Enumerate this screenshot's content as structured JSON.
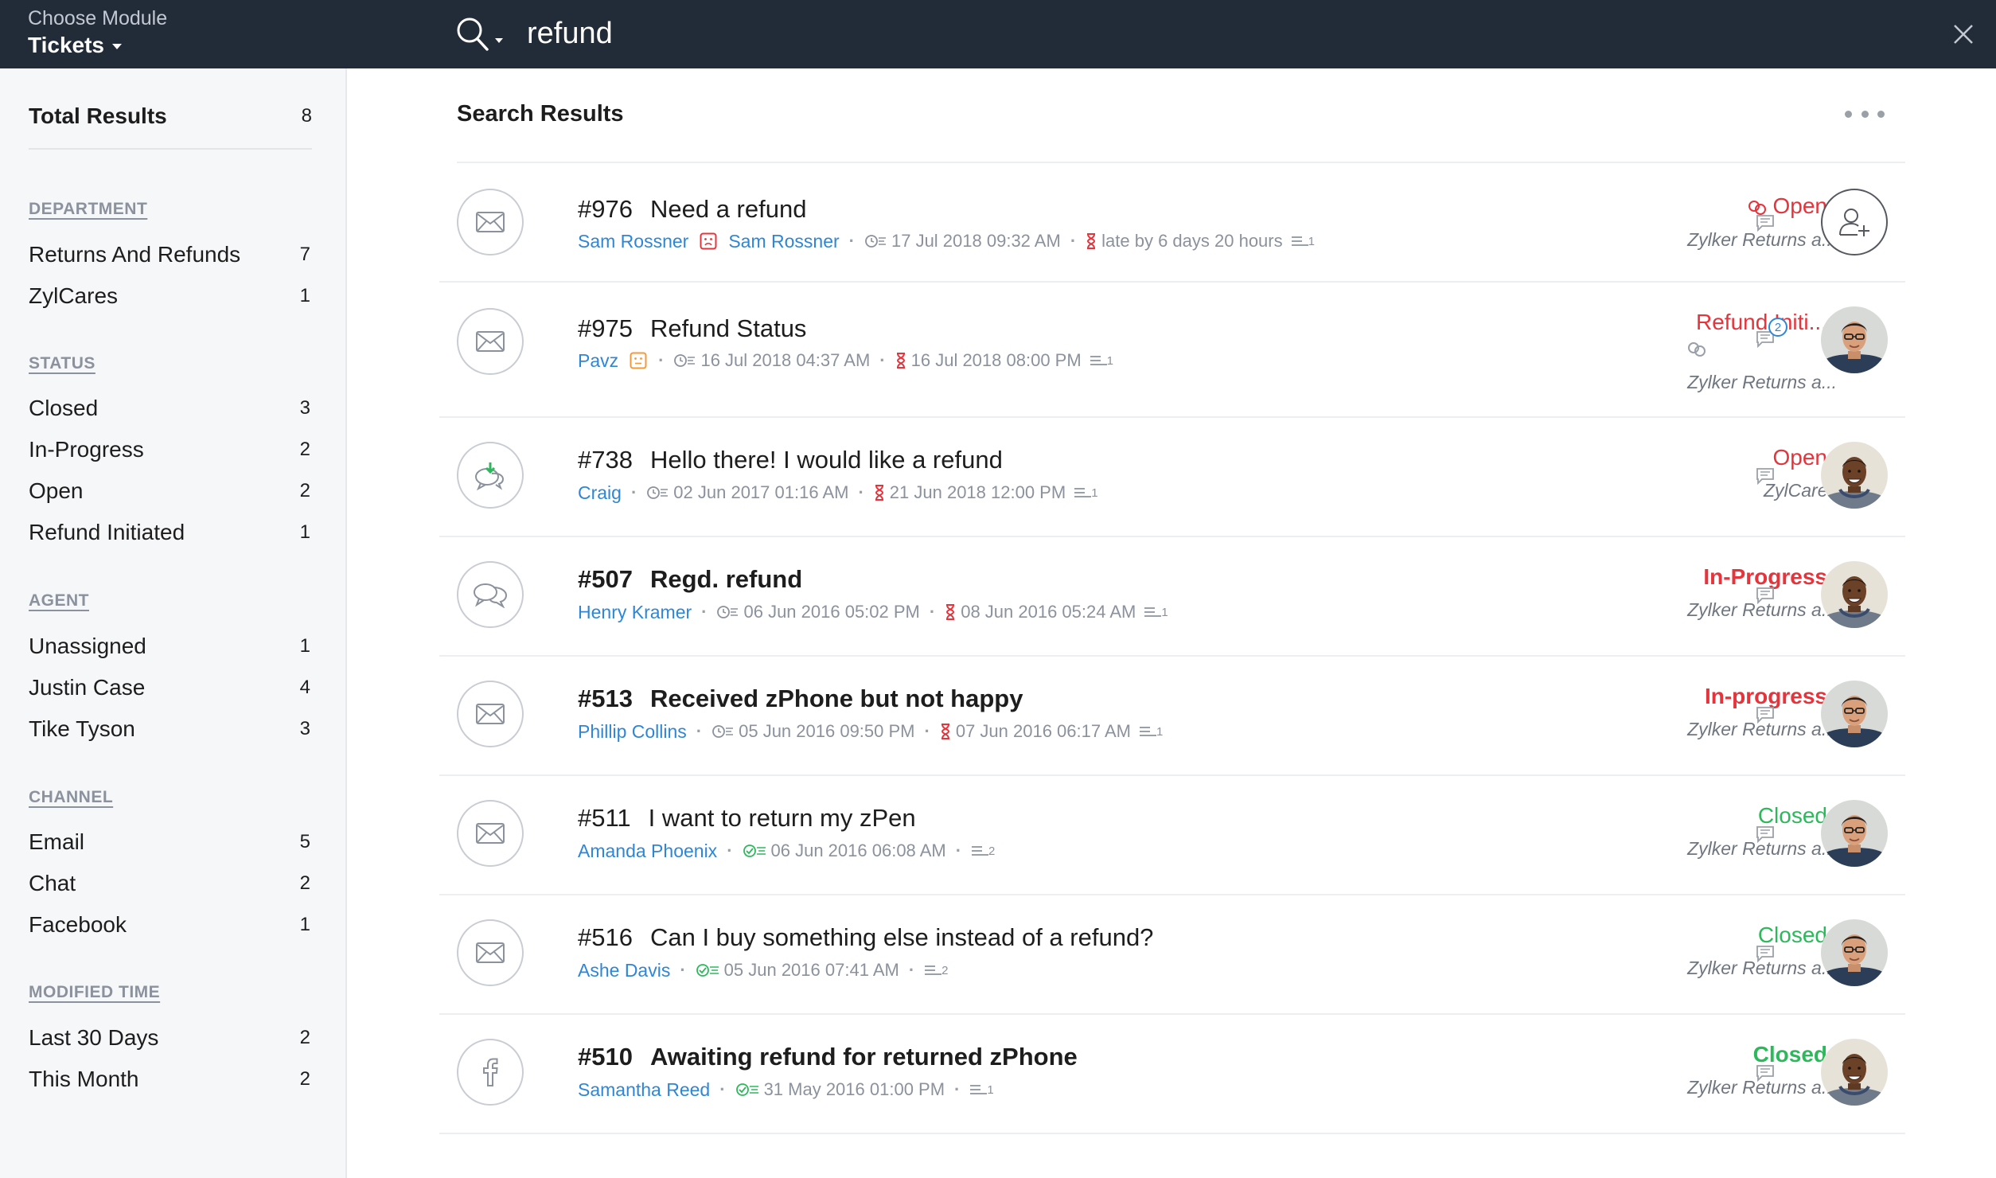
{
  "header": {
    "module_label": "Choose Module",
    "module_value": "Tickets",
    "search_value": "refund",
    "icons": {
      "search": "search-icon",
      "close": "close-icon",
      "dropdown": "chevron-down-icon"
    }
  },
  "sidebar": {
    "total_label": "Total Results",
    "total_count": "8",
    "groups": [
      {
        "heading": "DEPARTMENT",
        "items": [
          {
            "label": "Returns And Refunds",
            "count": "7"
          },
          {
            "label": "ZylCares",
            "count": "1"
          }
        ]
      },
      {
        "heading": "STATUS",
        "items": [
          {
            "label": "Closed",
            "count": "3"
          },
          {
            "label": "In-Progress",
            "count": "2"
          },
          {
            "label": "Open",
            "count": "2"
          },
          {
            "label": "Refund Initiated",
            "count": "1"
          }
        ]
      },
      {
        "heading": "AGENT",
        "items": [
          {
            "label": "Unassigned",
            "count": "1"
          },
          {
            "label": "Justin Case",
            "count": "4"
          },
          {
            "label": "Tike Tyson",
            "count": "3"
          }
        ]
      },
      {
        "heading": "CHANNEL",
        "items": [
          {
            "label": "Email",
            "count": "5"
          },
          {
            "label": "Chat",
            "count": "2"
          },
          {
            "label": "Facebook",
            "count": "1"
          }
        ]
      },
      {
        "heading": "MODIFIED TIME",
        "items": [
          {
            "label": "Last 30 Days",
            "count": "2"
          },
          {
            "label": "This Month",
            "count": "2"
          }
        ]
      }
    ]
  },
  "main": {
    "title": "Search Results",
    "tickets": [
      {
        "number": "#976",
        "subject": "Need a refund",
        "contact": "Sam Rossner",
        "account": "Sam Rossner",
        "created": "17 Jul 2018 09:32 AM",
        "due": "late by 6 days 20 hours",
        "threads": "1",
        "status": "Open",
        "department": "Zylker Returns a...",
        "channel": "envelope-icon"
      },
      {
        "number": "#975",
        "subject": "Refund Status",
        "contact": "Pavz",
        "created": "16 Jul 2018 04:37 AM",
        "due": "16 Jul 2018 08:00 PM",
        "threads": "1",
        "status": "Refund Initi...",
        "department": "Zylker Returns a...",
        "comments": "2",
        "channel": "envelope-icon"
      },
      {
        "number": "#738",
        "subject": "Hello there! I would like a refund",
        "contact": "Craig",
        "created": "02 Jun 2017 01:16 AM",
        "due": "21 Jun 2018 12:00 PM",
        "threads": "1",
        "status": "Open",
        "department": "ZylCares",
        "channel": "chat-icon"
      },
      {
        "number": "#507",
        "subject": "Regd. refund",
        "contact": "Henry Kramer",
        "created": "06 Jun 2016 05:02 PM",
        "due": "08 Jun 2016 05:24 AM",
        "threads": "1",
        "status": "In-Progress",
        "department": "Zylker Returns a...",
        "channel": "chat-icon"
      },
      {
        "number": "#513",
        "subject": "Received zPhone but not happy",
        "contact": "Phillip Collins",
        "created": "05 Jun 2016 09:50 PM",
        "due": "07 Jun 2016 06:17 AM",
        "threads": "1",
        "status": "In-progress",
        "department": "Zylker Returns a...",
        "channel": "envelope-icon"
      },
      {
        "number": "#511",
        "subject": "I want to return my zPen",
        "contact": "Amanda Phoenix",
        "created": "06 Jun 2016 06:08 AM",
        "threads": "2",
        "status": "Closed",
        "department": "Zylker Returns a...",
        "channel": "envelope-icon"
      },
      {
        "number": "#516",
        "subject": "Can I buy something else instead of a refund?",
        "contact": "Ashe Davis",
        "created": "05 Jun 2016 07:41 AM",
        "threads": "2",
        "status": "Closed",
        "department": "Zylker Returns a...",
        "channel": "envelope-icon"
      },
      {
        "number": "#510",
        "subject": "Awaiting refund for returned zPhone",
        "contact": "Samantha Reed",
        "created": "31 May 2016 01:00 PM",
        "threads": "1",
        "status": "Closed",
        "department": "Zylker Returns a...",
        "channel": "facebook-icon"
      }
    ]
  },
  "colors": {
    "topbar": "#222b38",
    "link": "#2e86d6",
    "status_open": "#e5343b",
    "status_closed": "#2eb85c"
  }
}
